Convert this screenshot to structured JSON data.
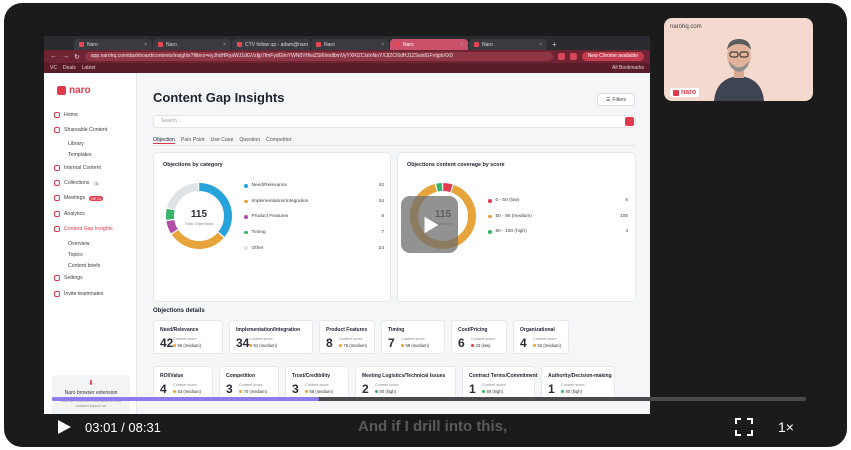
{
  "browser": {
    "tabs": [
      {
        "label": "Naro",
        "active": false
      },
      {
        "label": "Naro",
        "active": false
      },
      {
        "label": "CTV follow up - adam@naro",
        "active": false
      },
      {
        "label": "Naro",
        "active": false
      },
      {
        "label": "Naro",
        "active": true
      },
      {
        "label": "Naro",
        "active": false
      }
    ],
    "url": "app.narohq.com/dashboard/contents/insights?filters=eyJhdHRyaWJ1dGVzIjp7fmFydGlmYWN0VHlwZSI6ImdlbmVyYXRlZCIsInNoYXJlZCI6dHJ1ZSwidGFnIjpbXX0",
    "chrome_button": "New Chrome available",
    "bookmarks": [
      "VC",
      "Deals",
      "Latest"
    ],
    "all_bookmarks": "All Bookmarks"
  },
  "app": {
    "logo": "naro",
    "nav": [
      {
        "label": "Home",
        "type": "item"
      },
      {
        "label": "Shareable Content",
        "type": "item"
      },
      {
        "label": "Library",
        "type": "sub"
      },
      {
        "label": "Templates",
        "type": "sub"
      },
      {
        "label": "Internal Content",
        "type": "item"
      },
      {
        "label": "Collections",
        "type": "item",
        "count": "4"
      },
      {
        "label": "Meetings",
        "type": "item",
        "badge": "BETA"
      },
      {
        "label": "Analytics",
        "type": "item"
      },
      {
        "label": "Content Gap Insights",
        "type": "item",
        "active": true
      },
      {
        "label": "Overview",
        "type": "sub"
      },
      {
        "label": "Topics",
        "type": "sub"
      },
      {
        "label": "Content briefs",
        "type": "sub"
      },
      {
        "label": "Settings",
        "type": "item"
      },
      {
        "label": "Invite teammates",
        "type": "item"
      }
    ],
    "extension": {
      "title": "Naro browser extension",
      "desc": "Use our Chrome Extension to find content based on"
    },
    "page_title": "Content Gap Insights",
    "filters_label": "Filters",
    "search_placeholder": "Search...",
    "subtabs": [
      "Objection",
      "Pain Point",
      "Use Case",
      "Question",
      "Competitor"
    ],
    "category_card": {
      "title": "Objections by category",
      "total": "115",
      "total_label": "Total Objections",
      "items": [
        {
          "label": "Need/Relevance",
          "value": 42,
          "color": "#27a3dc"
        },
        {
          "label": "Implementation/Integration",
          "value": 34,
          "color": "#e6a43a"
        },
        {
          "label": "Product Features",
          "value": 8,
          "color": "#b34fa8"
        },
        {
          "label": "Timing",
          "value": 7,
          "color": "#37b36a"
        },
        {
          "label": "Other",
          "value": 24,
          "color": "#dfe2e7"
        }
      ]
    },
    "coverage_card": {
      "title": "Objections content coverage by score",
      "total": "115",
      "total_label": "Objections",
      "items": [
        {
          "label": "0 - 50 (low)",
          "value": 6,
          "color": "#e23a4d"
        },
        {
          "label": "50 - 80 (medium)",
          "value": 105,
          "color": "#e6a43a"
        },
        {
          "label": "80 - 100 (high)",
          "value": 4,
          "color": "#37b36a"
        }
      ]
    },
    "details_title": "Objections details",
    "score_label": "Content score",
    "details": [
      {
        "name": "Need/Relevance",
        "count": "42",
        "score": "56 (medium)",
        "level": "medium"
      },
      {
        "name": "Implementation/Integration",
        "count": "34",
        "score": "61 (medium)",
        "level": "medium"
      },
      {
        "name": "Product Features",
        "count": "8",
        "score": "75 (medium)",
        "level": "medium"
      },
      {
        "name": "Timing",
        "count": "7",
        "score": "58 (medium)",
        "level": "medium"
      },
      {
        "name": "Cost/Pricing",
        "count": "6",
        "score": "43 (low)",
        "level": "low"
      },
      {
        "name": "Organizational",
        "count": "4",
        "score": "52 (medium)",
        "level": "medium"
      },
      {
        "name": "ROI/Value",
        "count": "4",
        "score": "63 (medium)",
        "level": "medium"
      },
      {
        "name": "Competition",
        "count": "3",
        "score": "70 (medium)",
        "level": "medium"
      },
      {
        "name": "Trust/Credibility",
        "count": "3",
        "score": "68 (medium)",
        "level": "medium"
      },
      {
        "name": "Meeting Logistics/Technical Issues",
        "count": "2",
        "score": "80 (high)",
        "level": "high"
      },
      {
        "name": "Contract Terms/Commitment",
        "count": "1",
        "score": "80 (high)",
        "level": "high"
      },
      {
        "name": "Authority/Decision-making",
        "count": "1",
        "score": "80 (high)",
        "level": "high"
      }
    ]
  },
  "camera": {
    "domain": "narohq.com",
    "logo": "naro"
  },
  "player": {
    "time": "03:01 / 08:31",
    "progress": 0.354,
    "caption": "And if I drill into this,",
    "speed": "1×"
  },
  "colors": {
    "accent": "#e23a4d",
    "progress": "#8c7cf0",
    "low": "#e23a4d",
    "medium": "#e6a43a",
    "high": "#37b36a"
  }
}
